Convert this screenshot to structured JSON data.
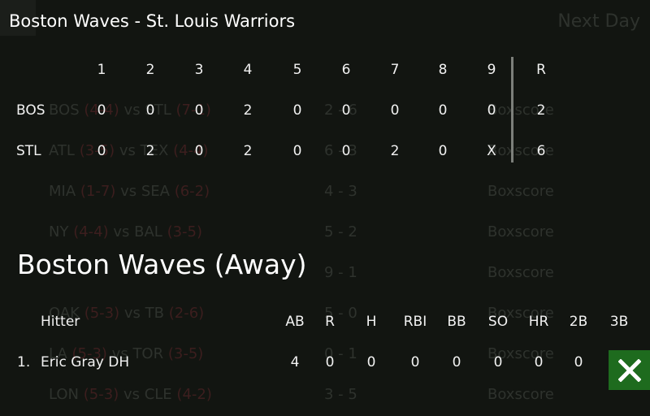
{
  "background": {
    "next_day_label": "Next Day",
    "games": [
      {
        "away": "BOS",
        "away_record": "(4-4)",
        "home": "STL",
        "home_record": "(7-1)",
        "score": "2 - 6",
        "link": "Boxscore"
      },
      {
        "away": "ATL",
        "away_record": "(3-5)",
        "home": "TEX",
        "home_record": "(4-4)",
        "score": "6 - 3",
        "link": "Boxscore"
      },
      {
        "away": "MIA",
        "away_record": "(1-7)",
        "home": "SEA",
        "home_record": "(6-2)",
        "score": "4 - 3",
        "link": "Boxscore"
      },
      {
        "away": "NY",
        "away_record": "(4-4)",
        "home": "BAL",
        "home_record": "(3-5)",
        "score": "5 - 2",
        "link": "Boxscore"
      },
      {
        "away": "",
        "away_record": "",
        "home": "",
        "home_record": "",
        "score": "9 - 1",
        "link": "Boxscore"
      },
      {
        "away": "OAK",
        "away_record": "(5-3)",
        "home": "TB",
        "home_record": "(2-6)",
        "score": "5 - 0",
        "link": "Boxscore"
      },
      {
        "away": "LA",
        "away_record": "(5-3)",
        "home": "TOR",
        "home_record": "(3-5)",
        "score": "0 - 1",
        "link": "Boxscore"
      },
      {
        "away": "LON",
        "away_record": "(5-3)",
        "home": "CLE",
        "home_record": "(4-2)",
        "score": "3 - 5",
        "link": "Boxscore"
      }
    ]
  },
  "title": "Boston Waves - St. Louis Warriors",
  "linescore": {
    "innings": [
      "1",
      "2",
      "3",
      "4",
      "5",
      "6",
      "7",
      "8",
      "9"
    ],
    "runs_header": "R",
    "rows": [
      {
        "team": "BOS",
        "innings": [
          "0",
          "0",
          "0",
          "2",
          "0",
          "0",
          "0",
          "0",
          "0"
        ],
        "runs": "2"
      },
      {
        "team": "STL",
        "innings": [
          "0",
          "2",
          "0",
          "2",
          "0",
          "0",
          "2",
          "0",
          "X"
        ],
        "runs": "6"
      }
    ]
  },
  "section_title": "Boston Waves (Away)",
  "hitters": {
    "header": {
      "name": "Hitter",
      "stats": [
        "AB",
        "R",
        "H",
        "RBI",
        "BB",
        "SO",
        "HR",
        "2B",
        "3B"
      ]
    },
    "rows": [
      {
        "num": "1.",
        "name": "Eric Gray DH",
        "stats": [
          "4",
          "0",
          "0",
          "0",
          "0",
          "0",
          "0",
          "0",
          ""
        ]
      }
    ]
  },
  "colors": {
    "close_button": "#1e6b1e",
    "background": "#121511"
  }
}
